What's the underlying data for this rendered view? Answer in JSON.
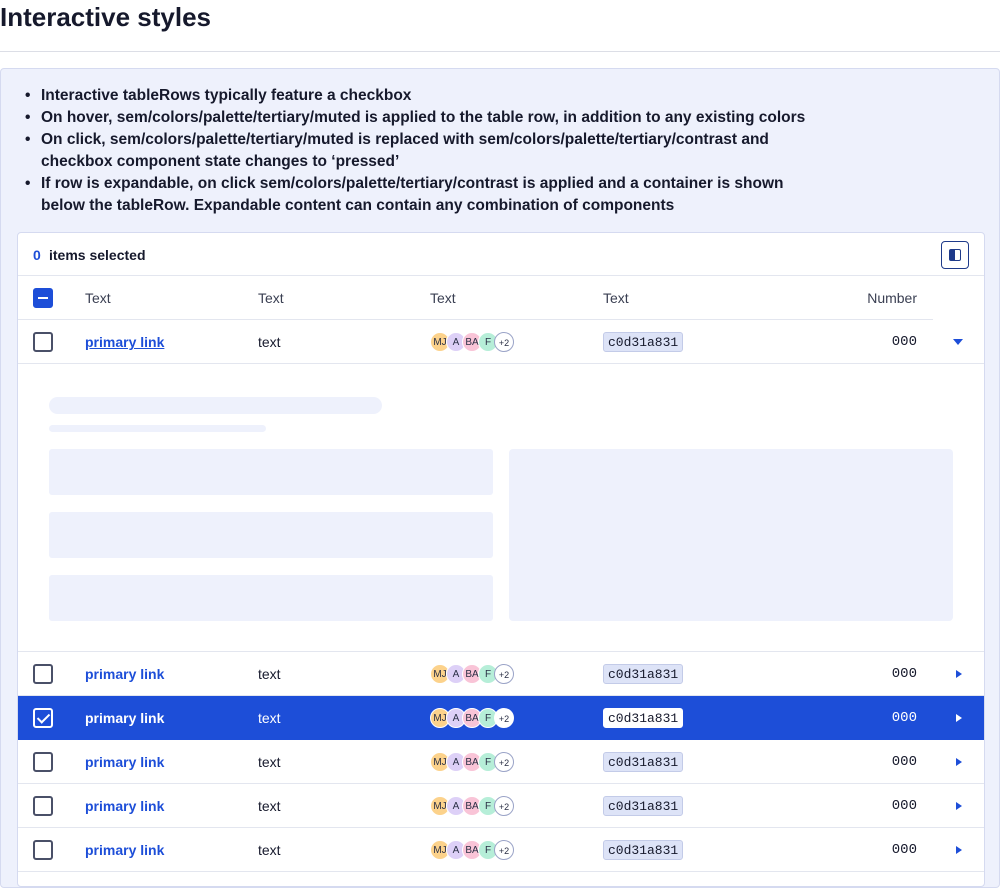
{
  "page": {
    "title": "Interactive styles"
  },
  "notes": [
    "Interactive tableRows typically feature a checkbox",
    "On hover, sem/colors/palette/tertiary/muted is applied to the table row, in addition to any existing colors",
    "On click, sem/colors/palette/tertiary/muted is replaced with sem/colors/palette/tertiary/contrast and checkbox component state changes to ‘pressed’",
    "If row is expandable, on click sem/colors/palette/tertiary/contrast is applied and a container is shown below the tableRow. Expandable content can contain any combination of components"
  ],
  "toolbar": {
    "selected_count": "0",
    "selected_label": "items selected",
    "columns_icon": "columns-icon"
  },
  "table": {
    "headers": [
      "Text",
      "Text",
      "Text",
      "Text",
      "Number"
    ],
    "avatars": [
      "MJ",
      "A",
      "BA",
      "F",
      "+2"
    ],
    "rows": [
      {
        "link": "primary link",
        "text": "text",
        "code": "c0d31a831",
        "number": "000",
        "state": "expanded"
      },
      {
        "link": "primary link",
        "text": "text",
        "code": "c0d31a831",
        "number": "000",
        "state": "default"
      },
      {
        "link": "primary link",
        "text": "text",
        "code": "c0d31a831",
        "number": "000",
        "state": "selected"
      },
      {
        "link": "primary link",
        "text": "text",
        "code": "c0d31a831",
        "number": "000",
        "state": "default"
      },
      {
        "link": "primary link",
        "text": "text",
        "code": "c0d31a831",
        "number": "000",
        "state": "default"
      },
      {
        "link": "primary link",
        "text": "text",
        "code": "c0d31a831",
        "number": "000",
        "state": "default"
      }
    ]
  },
  "colors": {
    "accent": "#1d4ed8",
    "panel": "#eef1fc",
    "skeleton": "#eef1fc",
    "text": "#16192c"
  }
}
